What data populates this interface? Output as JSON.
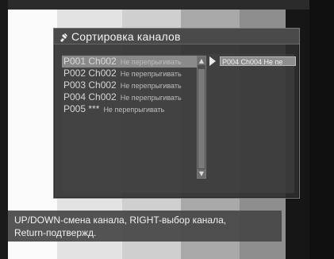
{
  "window": {
    "title": "Сортировка каналов"
  },
  "channels": [
    {
      "code": "P001 Ch002",
      "status": "Не перепрыгивать"
    },
    {
      "code": "P002 Ch002",
      "status": "Не перепрыгивать"
    },
    {
      "code": "P003 Ch002",
      "status": "Не перепрыгивать"
    },
    {
      "code": "P004 Ch002",
      "status": "Не перепрыгивать"
    },
    {
      "code": "P005 ***",
      "status": "Не перепрыгивать"
    }
  ],
  "selected_channel": {
    "label": "P004 Ch004 Не пе"
  },
  "help": {
    "line_1": "UP/DOWN-смена канала, RIGHT-выбор канала,",
    "line_2": "Return-подтвержд."
  },
  "icons": {
    "title": "screwdriver-icon",
    "scroll_up": "scroll-up-icon",
    "scroll_down": "scroll-down-icon",
    "selected": "play-icon"
  }
}
